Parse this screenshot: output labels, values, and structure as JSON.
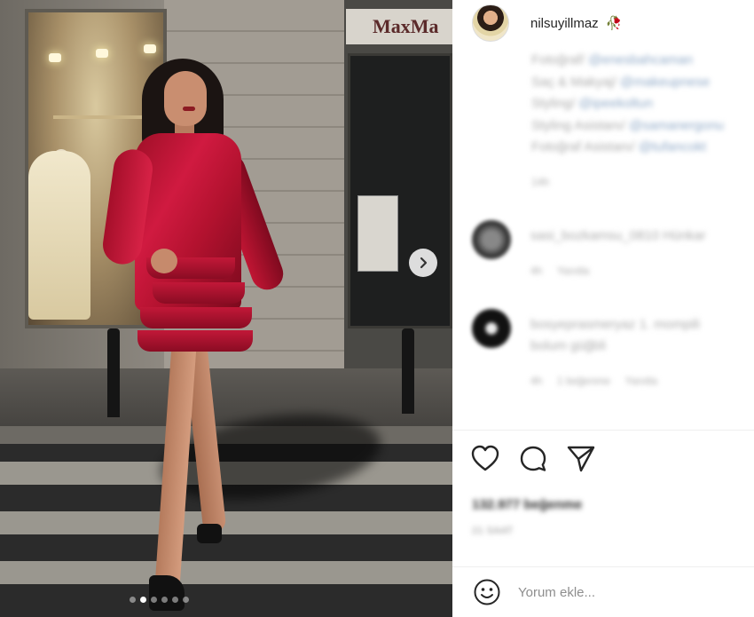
{
  "post": {
    "username": "nilsuyillmaz",
    "username_emoji": "🥀",
    "store_sign": "MaxMa",
    "carousel": {
      "slide_count": 6,
      "active_index": 1
    }
  },
  "caption": {
    "lines": [
      {
        "label": "Fotoğraf/",
        "mention": "@enesbahcaman"
      },
      {
        "label": "Saç & Makyaj/",
        "mention": "@makeupnese"
      },
      {
        "label": "Styling/",
        "mention": "@ipeekoltun"
      },
      {
        "label": "Styling Asistanı/",
        "mention": "@samanergonu"
      },
      {
        "label": "Fotoğraf Asistanı/",
        "mention": "@tufancokt"
      }
    ],
    "time": "14h"
  },
  "comments": [
    {
      "user": "sasi_bozkamsu_0810",
      "text": "Hünkar",
      "time": "4h",
      "likes": "",
      "reply": "Yanıtla"
    },
    {
      "user": "bosyeprasmeryaz",
      "text": "1. mompili",
      "line2": "bolum güğbli",
      "time": "4h",
      "likes": "1 beğenme",
      "reply": "Yanıtla"
    }
  ],
  "footer": {
    "likes": "132.977 beğenme",
    "date": "21 SAAT",
    "comment_placeholder": "Yorum ekle..."
  },
  "icons": {
    "like": "heart-icon",
    "comment": "comment-icon",
    "share": "send-icon",
    "emoji": "emoji-icon",
    "next": "chevron-right-icon"
  }
}
